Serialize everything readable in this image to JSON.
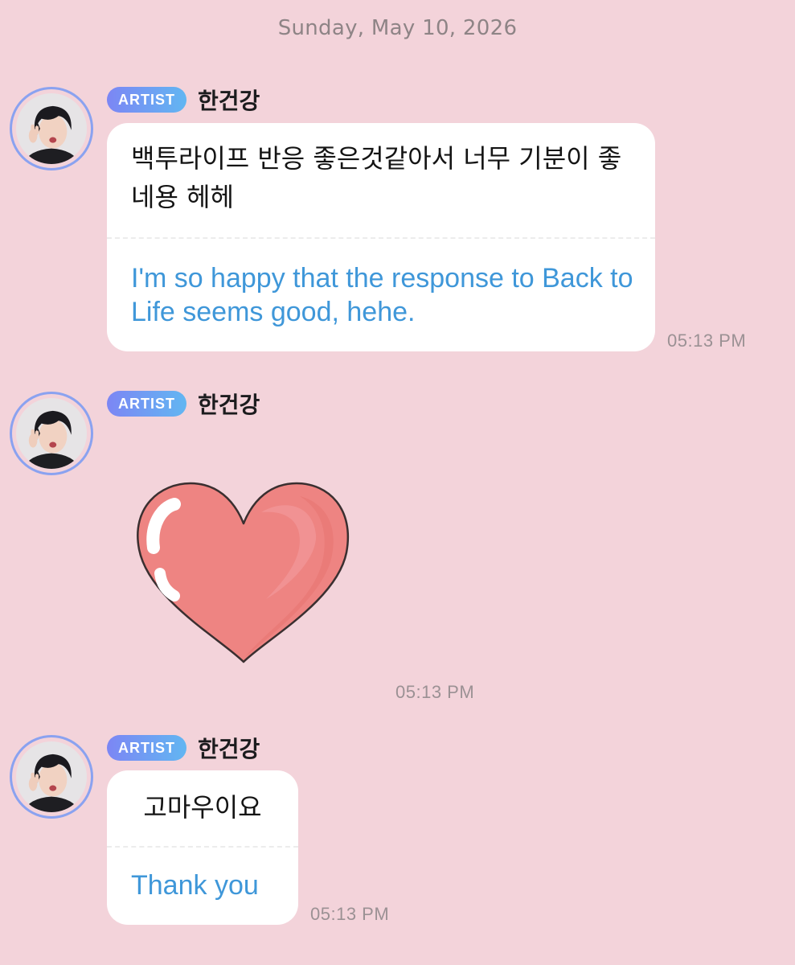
{
  "date_separator": "Sunday, May 10, 2026",
  "colors": {
    "background": "#f3d3da",
    "badge_start": "#7c86f4",
    "badge_end": "#62b6f2",
    "translation_text": "#3f97d9",
    "heart_fill": "#ee8482"
  },
  "messages": [
    {
      "badge": "ARTIST",
      "sender": "한건강",
      "original": "백투라이프 반응 좋은것같아서 너무 기분이 좋네용 헤헤",
      "translation": "I'm so happy that the response to Back to Life seems good, hehe.",
      "time": "05:13 PM"
    },
    {
      "badge": "ARTIST",
      "sender": "한건강",
      "sticker": "heart-sticker",
      "time": "05:13 PM"
    },
    {
      "badge": "ARTIST",
      "sender": "한건강",
      "original": "고마우이요",
      "translation": "Thank you",
      "time": "05:13 PM"
    }
  ]
}
